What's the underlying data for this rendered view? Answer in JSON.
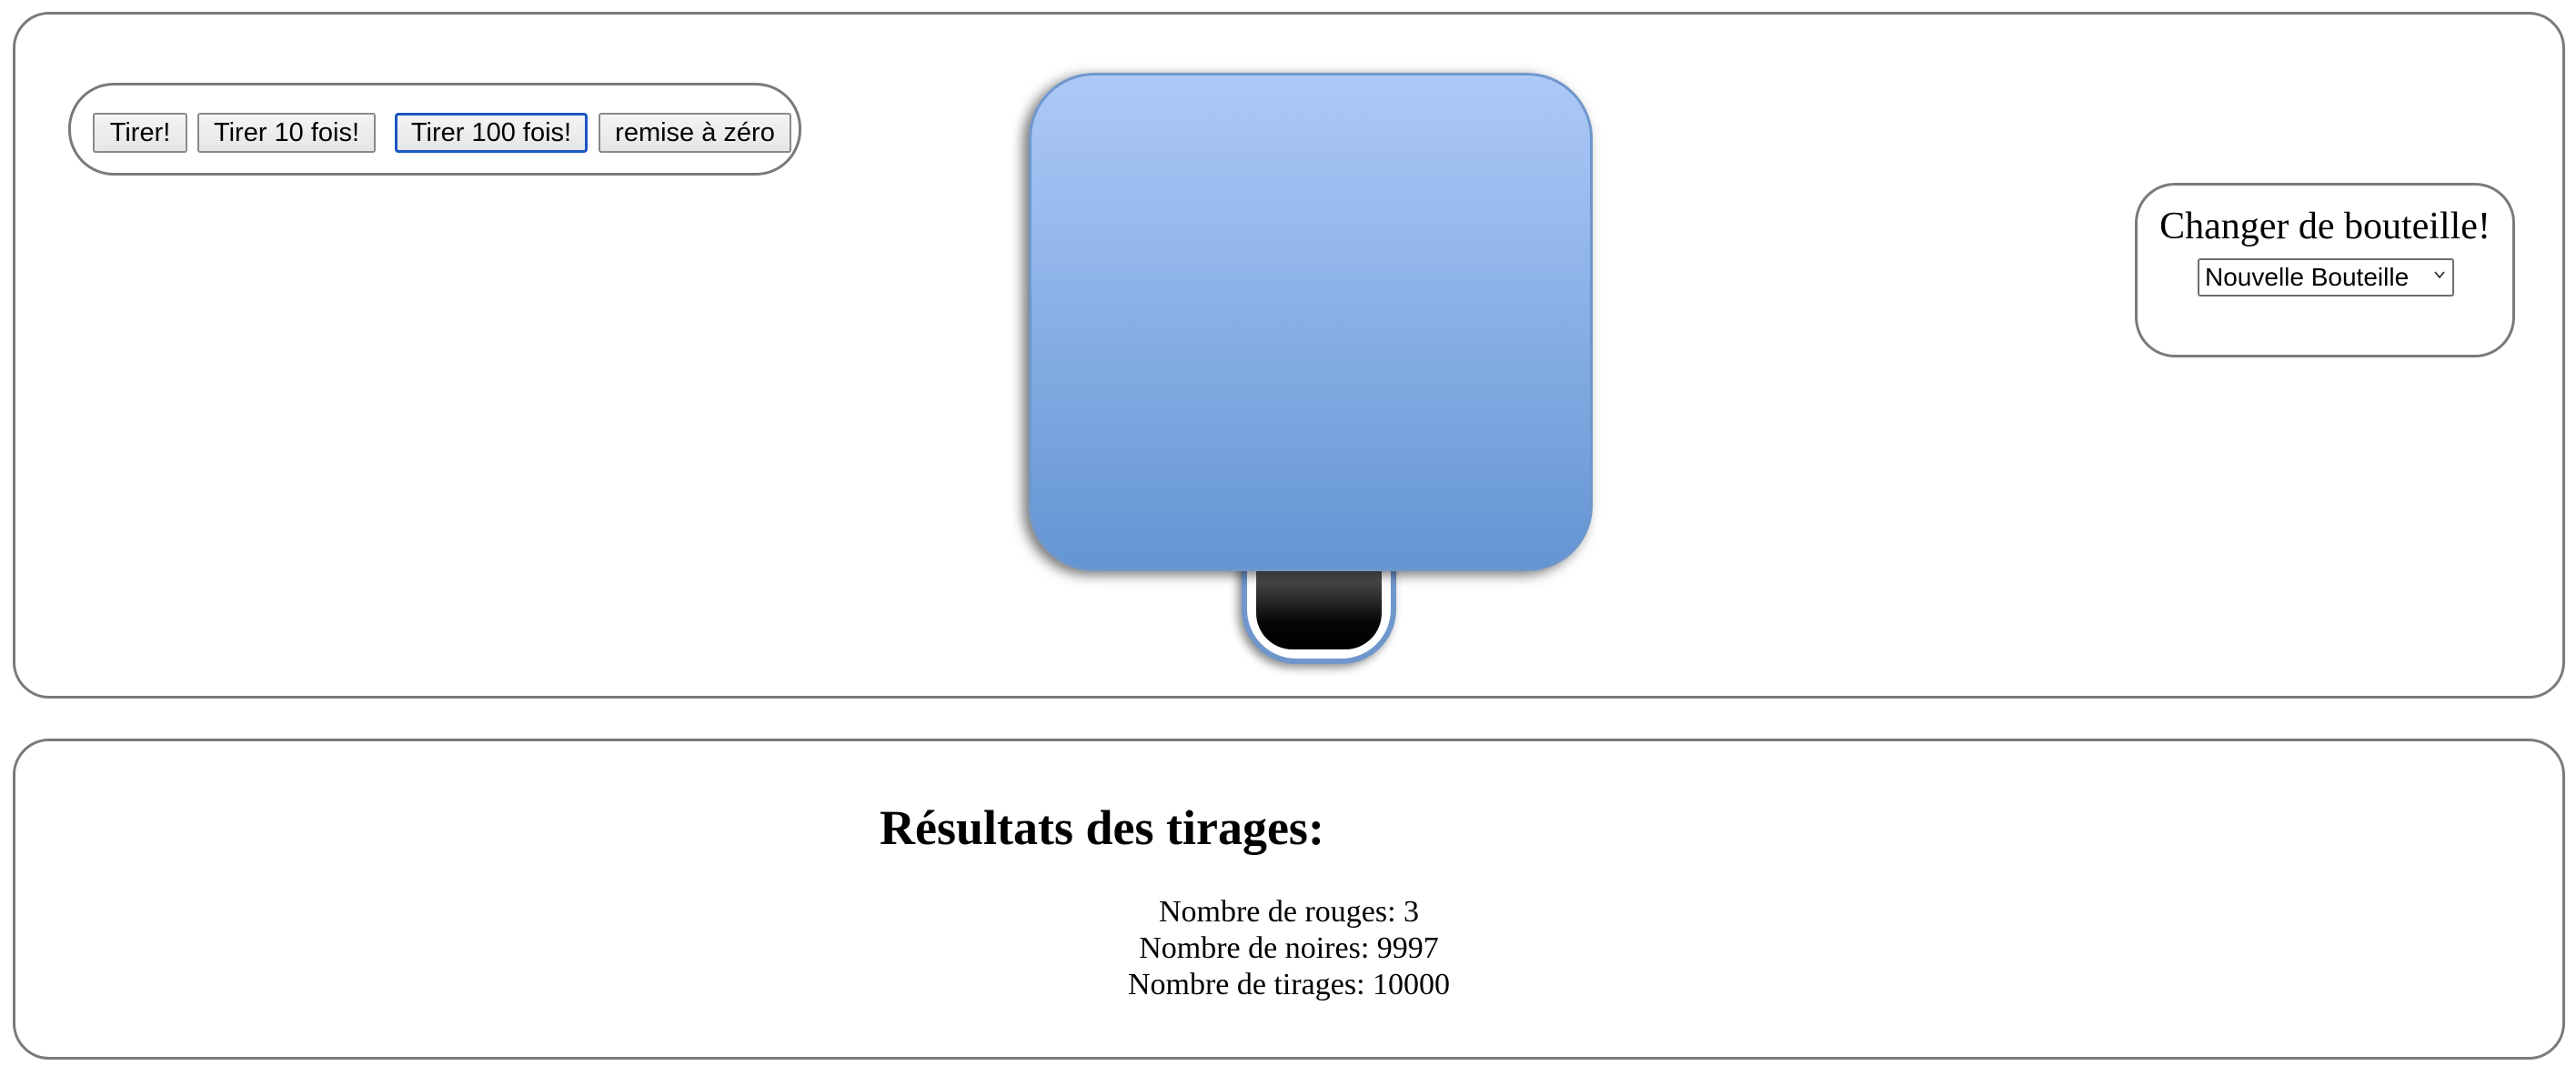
{
  "controls": {
    "draw_label": "Tirer!",
    "draw10_label": "Tirer 10 fois!",
    "draw100_label": "Tirer 100 fois!",
    "reset_label": "remise à zéro"
  },
  "bottle": {
    "body_color": "#8bb0e8",
    "ball_color": "black"
  },
  "change_bottle": {
    "title": "Changer de bouteille!",
    "selected_option": "Nouvelle Bouteille",
    "icon": "chevron-down-icon"
  },
  "results": {
    "title": "Résultats des tirages:",
    "red_label": "Nombre de rouges:",
    "red_count": "3",
    "black_label": "Nombre de noires:",
    "black_count": "9997",
    "total_label": "Nombre de tirages:",
    "total_count": "10000"
  },
  "colors": {
    "panel_border": "#7a7a7a",
    "focus_border": "#1a56c4",
    "bottle_gradient_top": "#adc9f7",
    "bottle_gradient_bottom": "#6495d4"
  }
}
